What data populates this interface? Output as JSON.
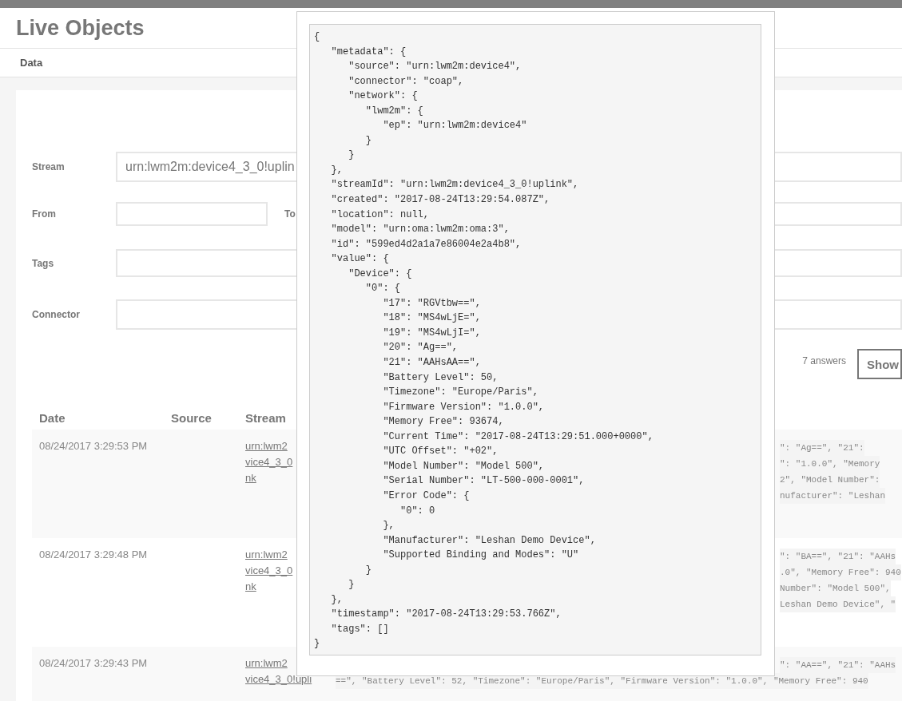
{
  "app": {
    "title": "Live Objects"
  },
  "nav": {
    "items": [
      {
        "label": "Data",
        "selected": true
      }
    ]
  },
  "filters": {
    "stream": {
      "label": "Stream",
      "value": "urn:lwm2m:device4_3_0!uplin"
    },
    "from": {
      "label": "From"
    },
    "to": {
      "label": "To"
    },
    "tags": {
      "label": "Tags"
    },
    "connector": {
      "label": "Connector"
    }
  },
  "results": {
    "count": "7 answers",
    "show_button": "Show"
  },
  "table": {
    "columns": [
      "Date",
      "Source",
      "Stream"
    ],
    "rows": [
      {
        "date": "08/24/2017 3:29:53 PM",
        "stream": [
          "urn:lwm2",
          "vice4_3_0",
          "nk"
        ],
        "value": [
          {
            "kind": "tail",
            "text": "\": \"Ag==\", \"21\":"
          },
          {
            "kind": "tail",
            "text": "\": \"1.0.0\", \"Memory"
          },
          {
            "kind": "tail",
            "text": "2\", \"Model Number\":"
          },
          {
            "kind": "tail",
            "text": "nufacturer\": \"Leshan"
          }
        ]
      },
      {
        "date": "08/24/2017 3:29:48 PM",
        "stream": [
          "urn:lwm2",
          "vice4_3_0",
          "nk"
        ],
        "value": [
          {
            "kind": "tail",
            "text": "\": \"BA==\", \"21\": \"AAHs"
          },
          {
            "kind": "tail",
            "text": ".0\", \"Memory Free\": 940"
          },
          {
            "kind": "tail",
            "text": "Number\": \"Model 500\","
          },
          {
            "kind": "tail",
            "text": "Leshan Demo Device\", \""
          }
        ]
      },
      {
        "date": "08/24/2017 3:29:43 PM",
        "stream": [
          "urn:lwm2",
          "vice4_3_0!upli"
        ],
        "value": [
          {
            "kind": "tail",
            "text": "\": \"AA==\", \"21\": \"AAHs"
          },
          {
            "kind": "full",
            "text": "==\", \"Battery Level\": 52, \"Timezone\": \"Europe/Paris\", \"Firmware Version\": \"1.0.0\", \"Memory Free\": 940"
          }
        ]
      }
    ]
  },
  "modal": {
    "code": "{\n   \"metadata\": {\n      \"source\": \"urn:lwm2m:device4\",\n      \"connector\": \"coap\",\n      \"network\": {\n         \"lwm2m\": {\n            \"ep\": \"urn:lwm2m:device4\"\n         }\n      }\n   },\n   \"streamId\": \"urn:lwm2m:device4_3_0!uplink\",\n   \"created\": \"2017-08-24T13:29:54.087Z\",\n   \"location\": null,\n   \"model\": \"urn:oma:lwm2m:oma:3\",\n   \"id\": \"599ed4d2a1a7e86004e2a4b8\",\n   \"value\": {\n      \"Device\": {\n         \"0\": {\n            \"17\": \"RGVtbw==\",\n            \"18\": \"MS4wLjE=\",\n            \"19\": \"MS4wLjI=\",\n            \"20\": \"Ag==\",\n            \"21\": \"AAHsAA==\",\n            \"Battery Level\": 50,\n            \"Timezone\": \"Europe/Paris\",\n            \"Firmware Version\": \"1.0.0\",\n            \"Memory Free\": 93674,\n            \"Current Time\": \"2017-08-24T13:29:51.000+0000\",\n            \"UTC Offset\": \"+02\",\n            \"Model Number\": \"Model 500\",\n            \"Serial Number\": \"LT-500-000-0001\",\n            \"Error Code\": {\n               \"0\": 0\n            },\n            \"Manufacturer\": \"Leshan Demo Device\",\n            \"Supported Binding and Modes\": \"U\"\n         }\n      }\n   },\n   \"timestamp\": \"2017-08-24T13:29:53.766Z\",\n   \"tags\": []\n}"
  }
}
